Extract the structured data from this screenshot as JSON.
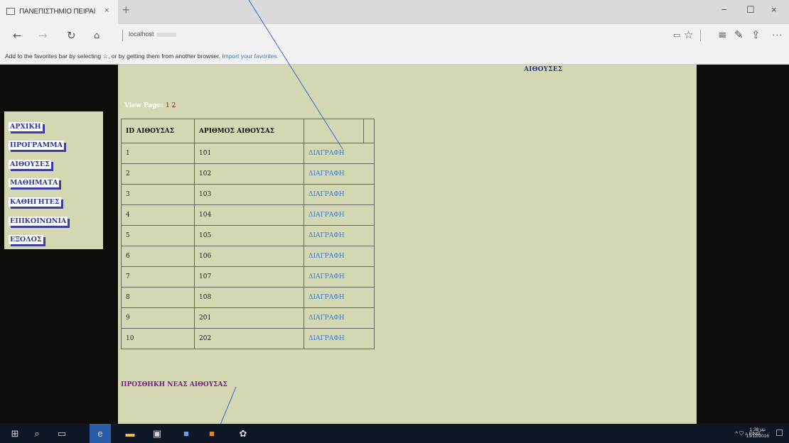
{
  "browser": {
    "tab_title": "ΠΑΝΕΠΙΣΤΗΜΙΟ ΠΕΙΡΑΙ",
    "tab_close": "×",
    "new_tab": "+",
    "url": "localhost",
    "window_buttons": [
      "−",
      "☐",
      "×"
    ],
    "nav_icons": [
      "back-icon",
      "forward-icon",
      "refresh-icon",
      "home-icon"
    ],
    "toolbar_icons": [
      "reading-view-icon",
      "favorite-star-icon",
      "hub-icon",
      "web-note-icon",
      "share-icon",
      "more-icon"
    ],
    "favorites_bar_text": "Add to the favorites bar by selecting ☆, or by getting them from another browser.",
    "favorites_bar_link": "Import your favorites"
  },
  "page": {
    "heading": "ΑΙΘΟΥΣΕΣ",
    "view_page_label": "View Page:",
    "page_numbers": "1 2",
    "menu": [
      {
        "label": "ΑΡΧΙΚΗ"
      },
      {
        "label": "ΠΡΟΓΡΑΜΜΑ"
      },
      {
        "label": "ΑΙΘΟΥΣΕΣ"
      },
      {
        "label": "ΜΑΘΗΜΑΤΑ"
      },
      {
        "label": "ΚΑΘΗΓΗΤΕΣ"
      },
      {
        "label": "ΕΠΙΚΟΙΝΩΝΙΑ"
      },
      {
        "label": "ΕΞΟΔΟΣ"
      }
    ],
    "table": {
      "headers": [
        "ID ΑΙΘΟΥΣΑΣ",
        "ΑΡΙΘΜΟΣ ΑΙΘΟΥΣΑΣ",
        "",
        ""
      ],
      "rows": [
        {
          "id": "1",
          "number": "101",
          "action": "ΔΙΑΓΡΑΦΗ"
        },
        {
          "id": "2",
          "number": "102",
          "action": "ΔΙΑΓΡΑΦΗ"
        },
        {
          "id": "3",
          "number": "103",
          "action": "ΔΙΑΓΡΑΦΗ"
        },
        {
          "id": "4",
          "number": "104",
          "action": "ΔΙΑΓΡΑΦΗ"
        },
        {
          "id": "5",
          "number": "105",
          "action": "ΔΙΑΓΡΑΦΗ"
        },
        {
          "id": "6",
          "number": "106",
          "action": "ΔΙΑΓΡΑΦΗ"
        },
        {
          "id": "7",
          "number": "107",
          "action": "ΔΙΑΓΡΑΦΗ"
        },
        {
          "id": "8",
          "number": "108",
          "action": "ΔΙΑΓΡΑΦΗ"
        },
        {
          "id": "9",
          "number": "201",
          "action": "ΔΙΑΓΡΑΦΗ"
        },
        {
          "id": "10",
          "number": "202",
          "action": "ΔΙΑΓΡΑΦΗ"
        }
      ]
    },
    "add_new_link": "ΠΡΟΣΘΗΚΗ ΝΕΑΣ ΑΙΘΟΥΣΑΣ"
  },
  "taskbar": {
    "icons": [
      "windows-start-icon",
      "search-icon",
      "task-view-icon",
      "edge-icon",
      "file-explorer-icon",
      "store-icon",
      "visual-studio-icon",
      "app-icon",
      "app-icon-2"
    ],
    "tray_text": "^ ⛉ ♪ ENG",
    "time": "1:38 μμ",
    "date": "13/12/2016"
  },
  "colors": {
    "content_bg": "#d3d8b3",
    "page_bg": "#0e0b09",
    "menu_text": "#2a3899",
    "link": "#3d7bd3",
    "add_link": "#7a1a8e"
  }
}
